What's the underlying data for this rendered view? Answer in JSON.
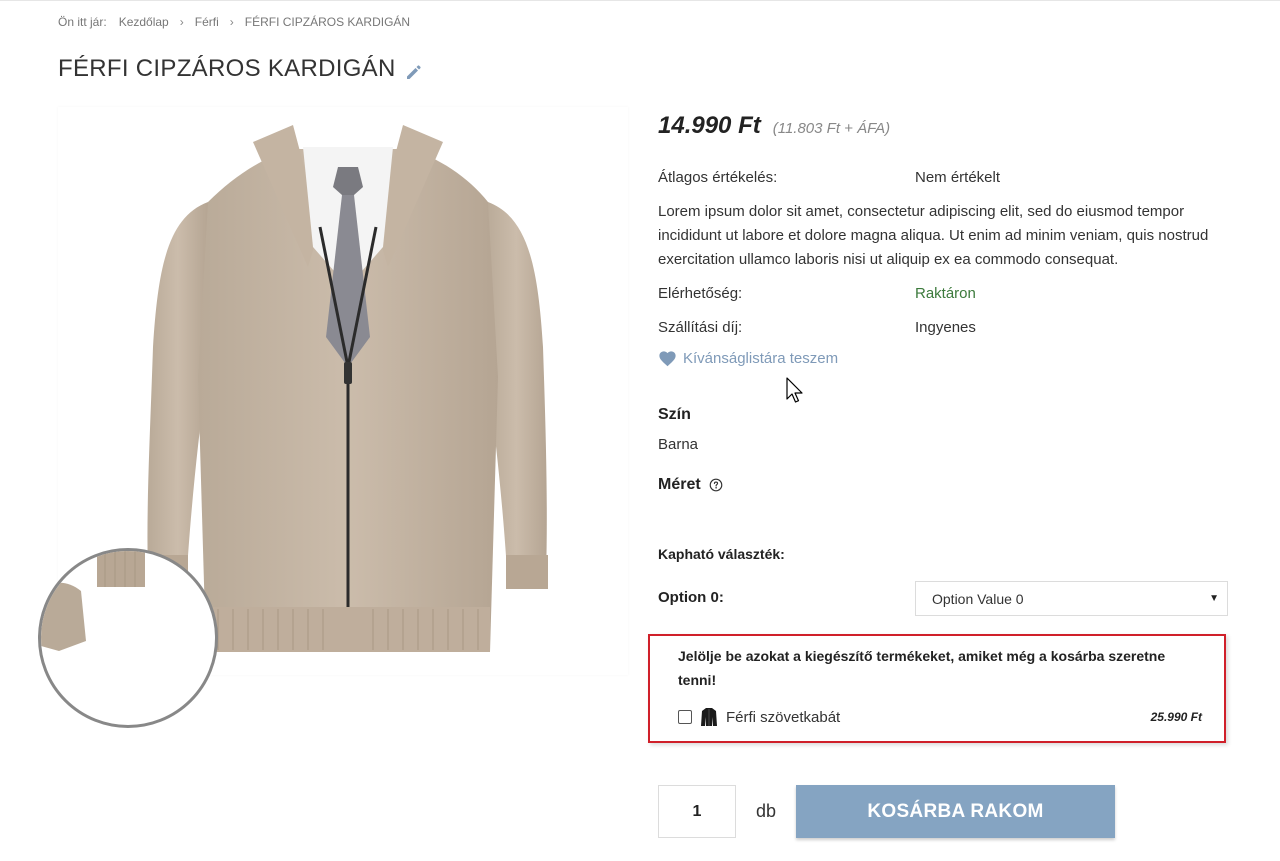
{
  "breadcrumb": {
    "prefix": "Ön itt jár:",
    "items": [
      "Kezdőlap",
      "Férfi",
      "FÉRFI CIPZÁROS KARDIGÁN"
    ],
    "separator": "›"
  },
  "product": {
    "title": "FÉRFI CIPZÁROS KARDIGÁN",
    "price": "14.990 Ft",
    "price_net": "(11.803 Ft + ÁFA)",
    "rating_label": "Átlagos értékelés:",
    "rating_value": "Nem értékelt",
    "description": "Lorem ipsum dolor sit amet, consectetur adipiscing elit, sed do eiusmod tempor incididunt ut labore et dolore magna aliqua. Ut enim ad minim veniam, quis nostrud exercitation ullamco laboris nisi ut aliquip ex ea commodo consequat.",
    "availability_label": "Elérhetőség:",
    "availability_value": "Raktáron",
    "shipping_label": "Szállítási díj:",
    "shipping_value": "Ingyenes",
    "wishlist_label": "Kívánságlistára teszem"
  },
  "variants": {
    "color_title": "Szín",
    "color_value": "Barna",
    "size_title": "Méret",
    "available_label": "Kapható választék:",
    "option_label": "Option 0:",
    "option_selected": "Option Value 0"
  },
  "accessories": {
    "title": "Jelölje be azokat a kiegészítő termékeket, amiket még a kosárba szeretne tenni!",
    "items": [
      {
        "name": "Férfi szövetkabát",
        "price": "25.990 Ft",
        "checked": false
      }
    ]
  },
  "cart": {
    "quantity": "1",
    "unit": "db",
    "button_label": "KOSÁRBA RAKOM"
  },
  "colors": {
    "accent_blue": "#85a4c2",
    "wishlist_blue": "#7f9ab8",
    "stock_green": "#3c7a3c",
    "highlight_red": "#d0202a"
  },
  "icons": {
    "edit": "pencil-icon",
    "wishlist": "heart-icon",
    "help": "help-circle-icon",
    "accessory": "jacket-icon",
    "select": "caret-down-icon"
  }
}
